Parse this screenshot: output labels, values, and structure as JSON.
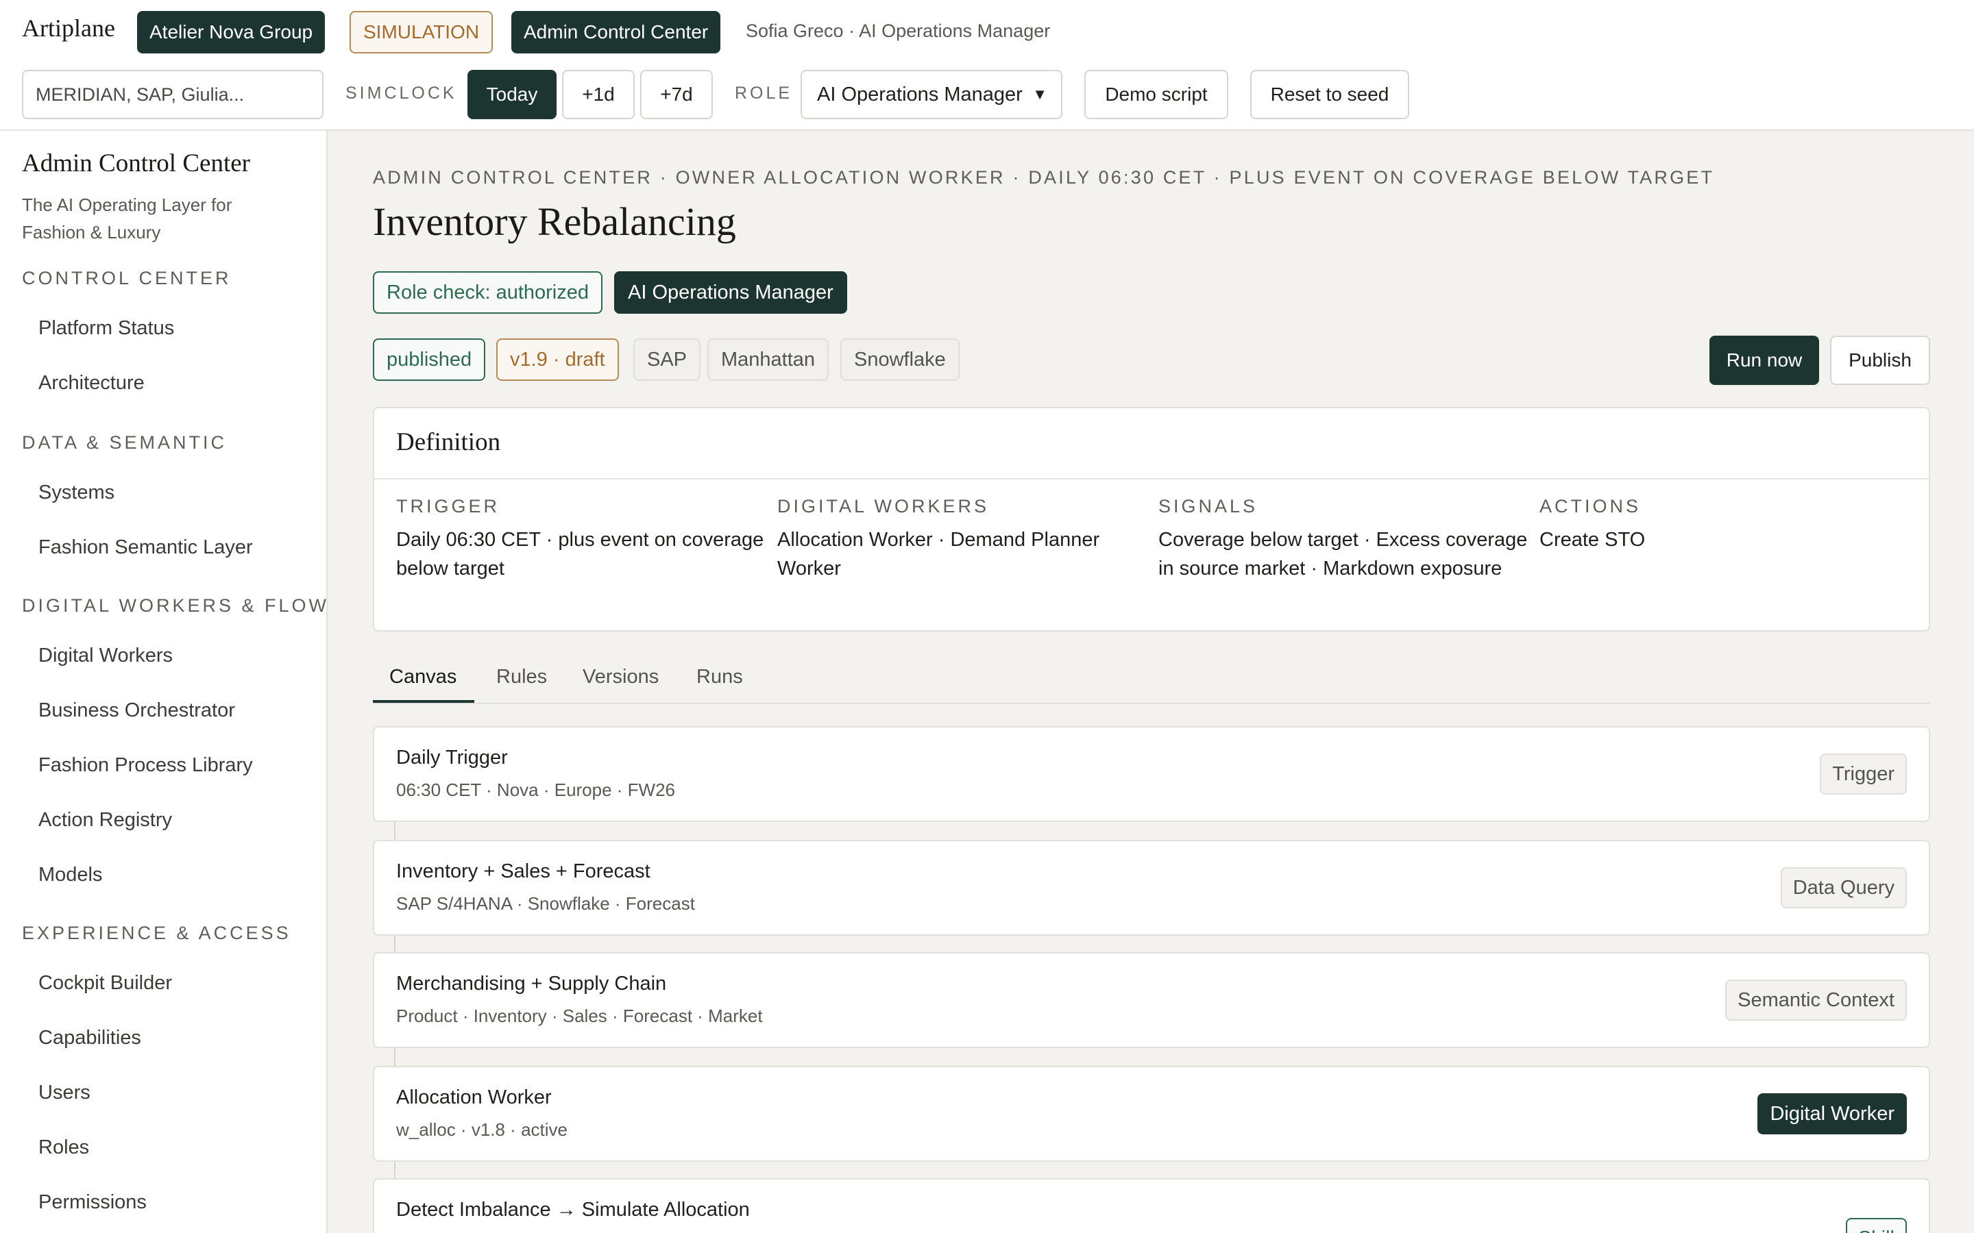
{
  "topbar": {
    "brand": "Artiplane",
    "org": "Atelier Nova Group",
    "mode": "SIMULATION",
    "console": "Admin Control Center",
    "user": "Sofia Greco · AI Operations Manager",
    "search_value": "MERIDIAN, SAP, Giulia...",
    "simclock_label": "SIMCLOCK",
    "clock_today": "Today",
    "clock_plus1": "+1d",
    "clock_plus7": "+7d",
    "role_label": "ROLE",
    "role_value": "AI Operations Manager",
    "demo_script": "Demo script",
    "reset_seed": "Reset to seed"
  },
  "sidebar": {
    "title": "Admin Control Center",
    "tagline": "The AI Operating Layer for Fashion & Luxury",
    "sections": [
      {
        "label": "CONTROL CENTER",
        "items": [
          "Platform Status",
          "Architecture"
        ]
      },
      {
        "label": "DATA & SEMANTIC",
        "items": [
          "Systems",
          "Fashion Semantic Layer"
        ]
      },
      {
        "label": "DIGITAL WORKERS & FLOW",
        "items": [
          "Digital Workers",
          "Business Orchestrator",
          "Fashion Process Library",
          "Action Registry",
          "Models"
        ]
      },
      {
        "label": "EXPERIENCE & ACCESS",
        "items": [
          "Cockpit Builder",
          "Capabilities",
          "Users",
          "Roles",
          "Permissions"
        ]
      }
    ]
  },
  "main": {
    "breadcrumb": "ADMIN CONTROL CENTER · OWNER ALLOCATION WORKER · DAILY 06:30 CET · PLUS EVENT ON COVERAGE BELOW TARGET",
    "title": "Inventory Rebalancing",
    "role_check": "Role check: authorized",
    "role_badge": "AI Operations Manager",
    "status": "published",
    "version": "v1.9 · draft",
    "systems": [
      "SAP",
      "Manhattan",
      "Snowflake"
    ],
    "run_now": "Run now",
    "publish": "Publish",
    "definition": {
      "heading": "Definition",
      "trigger_label": "TRIGGER",
      "trigger_value": "Daily 06:30 CET · plus event on coverage below target",
      "workers_label": "DIGITAL WORKERS",
      "workers_value": "Allocation Worker · Demand Planner Worker",
      "signals_label": "SIGNALS",
      "signals_value": "Coverage below target · Excess coverage in source market · Markdown exposure",
      "actions_label": "ACTIONS",
      "actions_value": "Create STO"
    },
    "tabs": [
      "Canvas",
      "Rules",
      "Versions",
      "Runs"
    ],
    "steps": [
      {
        "title": "Daily Trigger",
        "sub": "06:30 CET · Nova · Europe · FW26",
        "badge": "Trigger"
      },
      {
        "title": "Inventory + Sales + Forecast",
        "sub": "SAP S/4HANA · Snowflake · Forecast",
        "badge": "Data Query"
      },
      {
        "title": "Merchandising + Supply Chain",
        "sub": "Product · Inventory · Sales · Forecast · Market",
        "badge": "Semantic Context"
      },
      {
        "title": "Allocation Worker",
        "sub": "w_alloc · v1.8 · active",
        "badge": "Digital Worker"
      },
      {
        "title": "Detect Imbalance → Simulate Allocation",
        "sub": "",
        "badge": "Skill"
      }
    ]
  },
  "colors": {
    "accent_dark": "#1c3530",
    "accent_green": "#2d6a52",
    "accent_amber": "#a86a2a"
  }
}
